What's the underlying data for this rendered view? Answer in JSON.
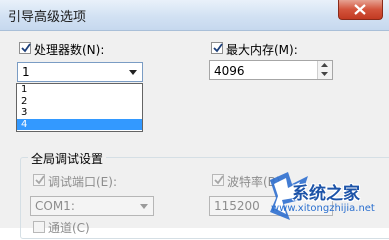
{
  "window": {
    "title": "引导高级选项"
  },
  "processors": {
    "checkbox_label": "处理器数(N):",
    "selected": "1",
    "options": [
      "1",
      "2",
      "3",
      "4"
    ],
    "highlighted_option": "4"
  },
  "memory": {
    "checkbox_label": "最大内存(M):",
    "value": "4096"
  },
  "debug": {
    "group_title": "全局调试设置",
    "port_label": "调试端口(E):",
    "port_value": "COM1:",
    "baud_label": "波特率(B):",
    "baud_value": "115200",
    "channel_label": "通道(C)"
  },
  "watermark": {
    "text": "系统之家",
    "url": "www.xitongzhijia.net"
  },
  "colors": {
    "selection": "#3399ff",
    "titlebar": "#d2e1f3",
    "close": "#c23a22"
  }
}
